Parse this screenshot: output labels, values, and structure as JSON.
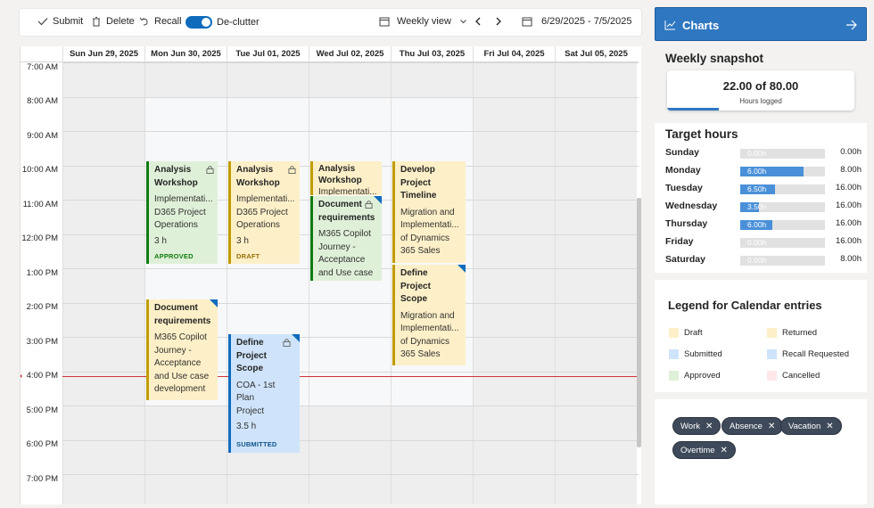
{
  "toolbar": {
    "submit": "Submit",
    "delete": "Delete",
    "recall": "Recall",
    "declutter": "De-clutter",
    "view": "Weekly view",
    "date_range": "6/29/2025 - 7/5/2025"
  },
  "calendar": {
    "days": [
      "Sun Jun 29, 2025",
      "Mon Jun 30, 2025",
      "Tue Jul 01, 2025",
      "Wed Jul 02, 2025",
      "Thu Jul 03, 2025",
      "Fri Jul 04, 2025",
      "Sat Jul 05, 2025"
    ],
    "times": [
      "7:00 AM",
      "8:00 AM",
      "9:00 AM",
      "10:00 AM",
      "11:00 AM",
      "12:00 PM",
      "1:00 PM",
      "2:00 PM",
      "3:00 PM",
      "4:00 PM",
      "5:00 PM",
      "6:00 PM",
      "7:00 PM"
    ],
    "events": [
      {
        "title": "Analysis Workshop",
        "lines": [
          "Implementati...",
          "D365 Project",
          "Operations",
          "3 h"
        ],
        "status": "APPROVED",
        "type": "approved",
        "locked": true
      },
      {
        "title": "Analysis Workshop",
        "lines": [
          "Implementati...",
          "D365 Project",
          "Operations",
          "3 h"
        ],
        "status": "DRAFT",
        "type": "draft",
        "locked": true
      },
      {
        "title": "Analysis Workshop",
        "lines": [
          "Implementati..."
        ],
        "status": "",
        "type": "draft",
        "locked": false
      },
      {
        "title": "Document requirements",
        "lines": [
          "M365 Copilot",
          "Journey -",
          "Acceptance",
          "and Use case"
        ],
        "status": "",
        "type": "approved",
        "locked": true
      },
      {
        "title": "Develop Project Timeline",
        "lines": [
          "Migration and",
          "Implementati...",
          "of Dynamics",
          "365 Sales"
        ],
        "status": "",
        "type": "draft",
        "locked": false
      },
      {
        "title": "Define Project Scope",
        "lines": [
          "Migration and",
          "Implementati...",
          "of Dynamics",
          "365 Sales"
        ],
        "status": "",
        "type": "draft",
        "locked": false
      },
      {
        "title": "Document requirements",
        "lines": [
          "M365 Copilot",
          "Journey -",
          "Acceptance",
          "and Use case",
          "development"
        ],
        "status": "",
        "type": "draft",
        "locked": false
      },
      {
        "title": "Define Project Scope",
        "lines": [
          "COA - 1st Plan",
          "Project",
          "3.5 h"
        ],
        "status": "SUBMITTED",
        "type": "submitted",
        "locked": true
      }
    ]
  },
  "charts": {
    "label": "Charts"
  },
  "snapshot": {
    "title": "Weekly snapshot",
    "value": "22.00 of 80.00",
    "label": "Hours logged",
    "fraction": 0.275
  },
  "target": {
    "title": "Target hours",
    "rows": [
      {
        "day": "Sunday",
        "logged": "0.00h",
        "target": "0.00h",
        "fraction": 0
      },
      {
        "day": "Monday",
        "logged": "6.00h",
        "target": "8.00h",
        "fraction": 0.75
      },
      {
        "day": "Tuesday",
        "logged": "6.50h",
        "target": "16.00h",
        "fraction": 0.406
      },
      {
        "day": "Wednesday",
        "logged": "3.50h",
        "target": "16.00h",
        "fraction": 0.219
      },
      {
        "day": "Thursday",
        "logged": "6.00h",
        "target": "16.00h",
        "fraction": 0.375
      },
      {
        "day": "Friday",
        "logged": "0.00h",
        "target": "16.00h",
        "fraction": 0
      },
      {
        "day": "Saturday",
        "logged": "0.00h",
        "target": "8.00h",
        "fraction": 0
      }
    ]
  },
  "legend": {
    "title": "Legend for Calendar entries",
    "items": [
      {
        "label": "Draft",
        "color": "#fdf0c8"
      },
      {
        "label": "Returned",
        "color": "#fdf0c8"
      },
      {
        "label": "Submitted",
        "color": "#cfe4fa"
      },
      {
        "label": "Recall Requested",
        "color": "#cfe4fa"
      },
      {
        "label": "Approved",
        "color": "#dff0d8"
      },
      {
        "label": "Cancelled",
        "color": "#fde7e9"
      }
    ]
  },
  "filters": [
    "Work",
    "Absence",
    "Vacation",
    "Overtime"
  ],
  "colors": {
    "accent": "#0f6cbd",
    "approved": "#107c10",
    "draft": "#c19c00",
    "now_line": "#d13438"
  }
}
